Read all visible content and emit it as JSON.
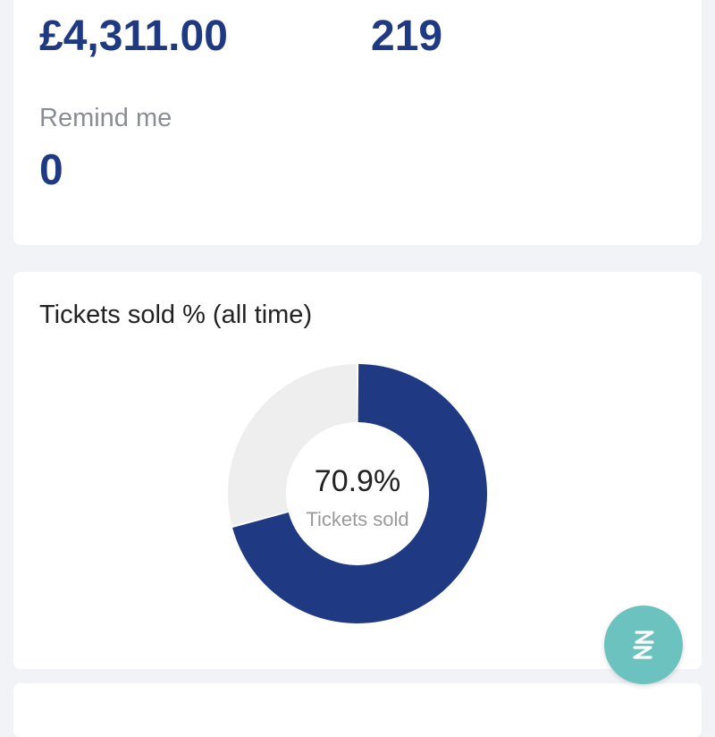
{
  "summary": {
    "revenue_value": "£4,311.00",
    "tickets_value": "219",
    "remind_label": "Remind me",
    "remind_value": "0"
  },
  "chart_card": {
    "title": "Tickets sold % (all time)",
    "center_value": "70.9%",
    "center_label": "Tickets sold"
  },
  "chart_data": {
    "type": "pie",
    "title": "Tickets sold % (all time)",
    "slices": [
      {
        "label": "Tickets sold",
        "value": 70.9,
        "color": "#1f3a83"
      },
      {
        "label": "",
        "value": 29.1,
        "color": "#eeeeee"
      }
    ]
  },
  "colors": {
    "accent": "#1f3a83",
    "fab": "#6cc2be",
    "background": "#f2f3f7"
  },
  "fab": {
    "icon": "app-logo-icon"
  }
}
